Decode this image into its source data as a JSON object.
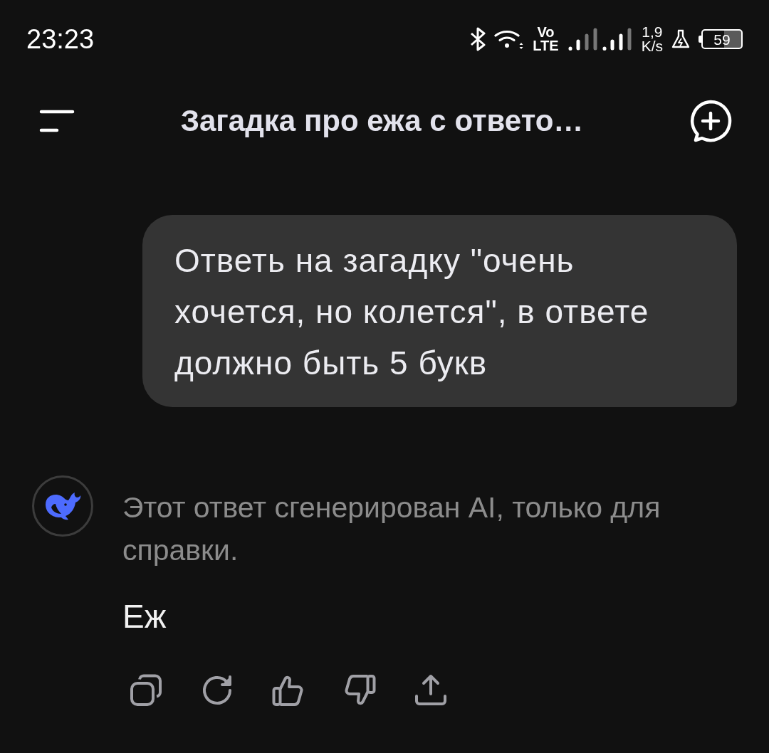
{
  "status_bar": {
    "time": "23:23",
    "network_top": "Vo",
    "network_bottom": "LTE",
    "speed_value": "1,9",
    "speed_unit": "K/s",
    "battery": "59"
  },
  "header": {
    "title": "Загадка про ежа с ответо…"
  },
  "messages": [
    {
      "kind": "user",
      "text": "Ответь на загадку \"очень хочется, но колется\", в ответе должно быть 5 букв"
    },
    {
      "kind": "assistant",
      "disclaimer": "Этот ответ сгенерирован AI, только для справки.",
      "text": "Еж"
    }
  ]
}
